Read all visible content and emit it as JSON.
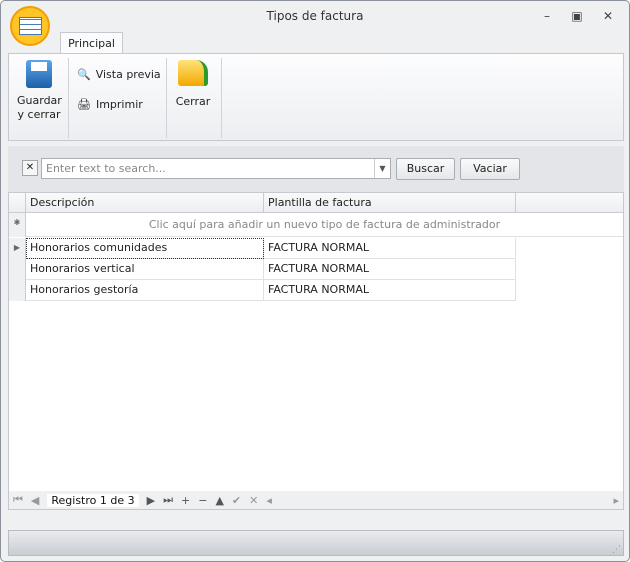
{
  "window": {
    "title": "Tipos de factura",
    "controls": [
      "minimize",
      "maximize",
      "close"
    ]
  },
  "ribbon": {
    "tab": "Principal",
    "save": "Guardar y cerrar",
    "preview": "Vista previa",
    "print": "Imprimir",
    "close": "Cerrar"
  },
  "search": {
    "placeholder": "Enter text to search...",
    "find": "Buscar",
    "clear": "Vaciar"
  },
  "grid": {
    "columns": [
      "Descripción",
      "Plantilla de factura"
    ],
    "new_row_hint": "Clic aquí para añadir un nuevo tipo de factura de administrador",
    "rows": [
      {
        "desc": "Honorarios comunidades",
        "tpl": "FACTURA NORMAL"
      },
      {
        "desc": "Honorarios vertical",
        "tpl": "FACTURA NORMAL"
      },
      {
        "desc": "Honorarios gestoría",
        "tpl": "FACTURA NORMAL"
      }
    ]
  },
  "navigator": {
    "record": "Registro 1 de 3"
  }
}
